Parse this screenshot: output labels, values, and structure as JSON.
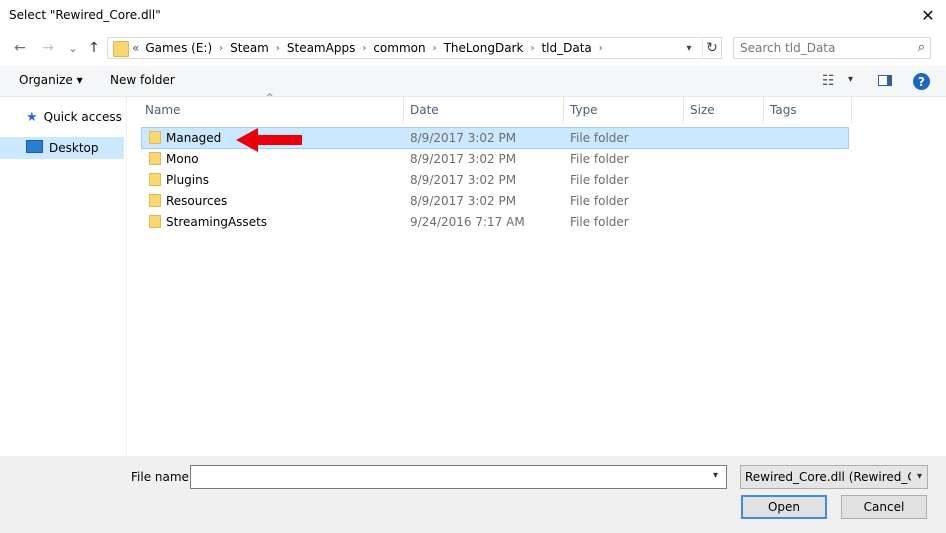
{
  "window": {
    "title": "Select \"Rewired_Core.dll\""
  },
  "nav": {
    "back": "←",
    "forward": "→",
    "recent": "⌄",
    "up": "↑",
    "breadcrumb": [
      "«",
      "Games (E:)",
      "Steam",
      "SteamApps",
      "common",
      "TheLongDark",
      "tld_Data"
    ],
    "search_placeholder": "Search tld_Data"
  },
  "toolbar": {
    "organize": "Organize ▾",
    "new_folder": "New folder",
    "help": "?"
  },
  "sidebar": {
    "items": [
      {
        "label": "Quick access"
      },
      {
        "label": "Desktop"
      }
    ]
  },
  "columns": {
    "name": "Name",
    "date": "Date",
    "type": "Type",
    "size": "Size",
    "tags": "Tags"
  },
  "files": [
    {
      "name": "Managed",
      "date": "8/9/2017 3:02 PM",
      "type": "File folder"
    },
    {
      "name": "Mono",
      "date": "8/9/2017 3:02 PM",
      "type": "File folder"
    },
    {
      "name": "Plugins",
      "date": "8/9/2017 3:02 PM",
      "type": "File folder"
    },
    {
      "name": "Resources",
      "date": "8/9/2017 3:02 PM",
      "type": "File folder"
    },
    {
      "name": "StreamingAssets",
      "date": "9/24/2016 7:17 AM",
      "type": "File folder"
    }
  ],
  "footer": {
    "file_name_label": "File name:",
    "file_name_value": "",
    "filter": "Rewired_Core.dll (Rewired_Core",
    "open": "Open",
    "cancel": "Cancel"
  },
  "colors": {
    "selection": "#cce8ff",
    "annotation_arrow": "#e8000b",
    "accent": "#1b64c8"
  }
}
